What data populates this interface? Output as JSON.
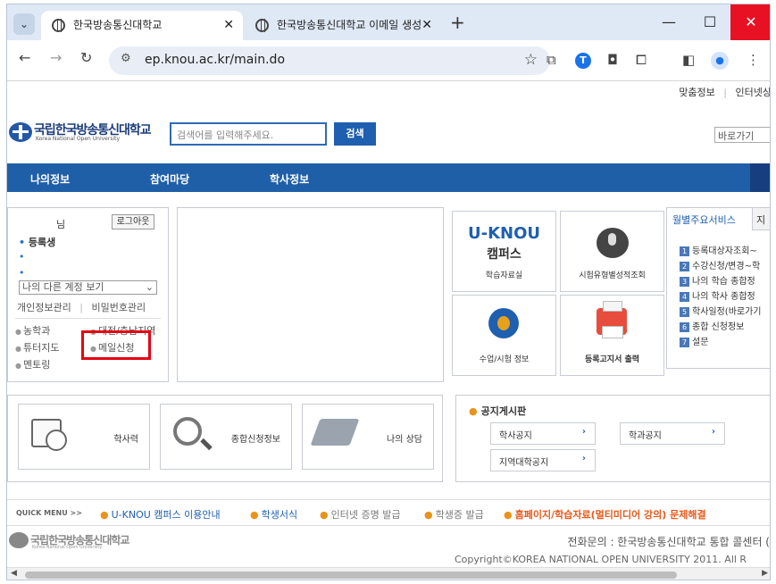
{
  "browser": {
    "tabs": [
      {
        "title": "한국방송통신대학교",
        "close": "✕"
      },
      {
        "title": "한국방송통신대학교 이메일 생성",
        "close": "✕"
      }
    ],
    "new_tab": "+",
    "url": "ep.knou.ac.kr/main.do",
    "window": {
      "minimize": "—",
      "maximize": "☐",
      "close": "✕"
    }
  },
  "site": {
    "util_links": [
      "맞춤정보",
      "|",
      "인터넷상"
    ],
    "logo_text": "국립한국방송통신대학교",
    "logo_en": "Korea National Open University",
    "search_placeholder": "검색어를 입력해주세요.",
    "search_button": "검색",
    "jump_label": "바로가기",
    "nav": [
      "나의정보",
      "참여마당",
      "학사정보"
    ]
  },
  "user": {
    "suffix": "님",
    "logout": "로그아웃",
    "status": "등록생",
    "bullet": "•",
    "account_select": "나의 다른 계정 보기",
    "links": [
      "개인정보관리",
      "|",
      "비밀번호관리"
    ],
    "quick_links": [
      "농학과",
      "대전/충남지역",
      "튜터지도",
      "메일신청",
      "멘토링"
    ]
  },
  "tiles": {
    "uknou": "U-KNOU",
    "campus": "캠퍼스",
    "tile1": "학습자료실",
    "tile2": "시험유형별성적조회",
    "tile3": "수업/시험 정보",
    "tile4": "등록고지서 출력"
  },
  "weekly": {
    "tab_on": "월별주요서비스",
    "tab_off": "지",
    "items": [
      {
        "n": "1",
        "t": "등록대상자조회~"
      },
      {
        "n": "2",
        "t": "수강신청/변경~학"
      },
      {
        "n": "3",
        "t": "나의 학습 종합정"
      },
      {
        "n": "4",
        "t": "나의 학사 종합정"
      },
      {
        "n": "5",
        "t": "학사일정(바로가기"
      },
      {
        "n": "6",
        "t": "종합 신청정보"
      },
      {
        "n": "7",
        "t": "설문"
      }
    ]
  },
  "services": [
    "학사력",
    "종합신청정보",
    "나의 상담"
  ],
  "notice": {
    "title": "공지게시판",
    "buttons": [
      "학사공지",
      "학과공지",
      "지역대학공지"
    ],
    "chevron": "›"
  },
  "quickmenu": {
    "label": "QUICK MENU >>",
    "items": [
      {
        "text": "U-KNOU 캠퍼스 이용안내",
        "color": "#1f5fb0"
      },
      {
        "text": "학생서식",
        "color": "#1f5fb0"
      },
      {
        "text": "인터넷 증명 발급",
        "color": "#777777"
      },
      {
        "text": "학생증 발급",
        "color": "#777777"
      },
      {
        "text": "홈페이지/학습자료(멀티미디어 강의) 문제해결",
        "color": "#e8581a"
      }
    ]
  },
  "footer": {
    "info": "전화문의 : 한국방송통신대학교 통합 콜센터 (",
    "copyright": "Copyright©KOREA NATIONAL OPEN UNIVERSITY 2011. All R"
  },
  "colors": {
    "accent": "#1f5fa8",
    "highlight": "#e60012"
  }
}
